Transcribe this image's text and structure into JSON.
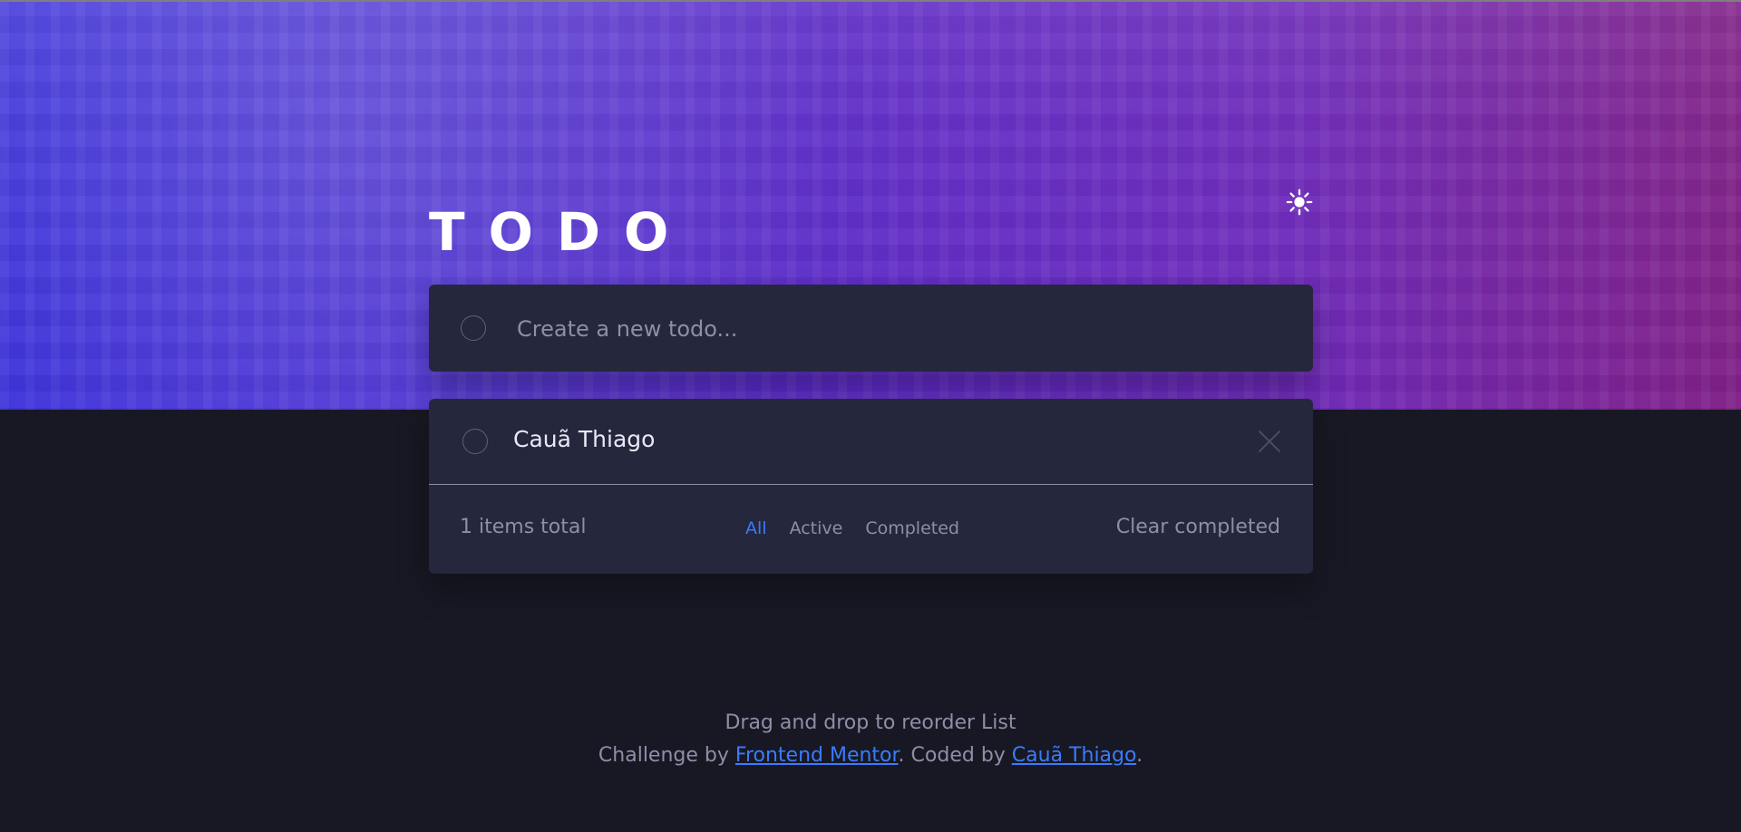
{
  "app": {
    "title": "TODO",
    "theme_icon": "sun-icon"
  },
  "input": {
    "placeholder": "Create a new todo..."
  },
  "todos": [
    {
      "label": "Cauã Thiago"
    }
  ],
  "footer": {
    "items_total": "1 items total",
    "filters": [
      "All",
      "Active",
      "Completed"
    ],
    "active_filter": "All",
    "clear_completed": "Clear completed"
  },
  "attribution": {
    "line1": "Drag and drop to reorder List",
    "line2_prefix": "Challenge by ",
    "frontend_mentor": "Frontend Mentor",
    "middle": ". Coded by ",
    "author": "Cauã Thiago",
    "suffix": "."
  },
  "colors": {
    "background": "#181824",
    "card": "#25273d",
    "accent": "#3a7bfd",
    "muted_text": "#8d8fa7",
    "main_text": "#e8e9f5"
  }
}
